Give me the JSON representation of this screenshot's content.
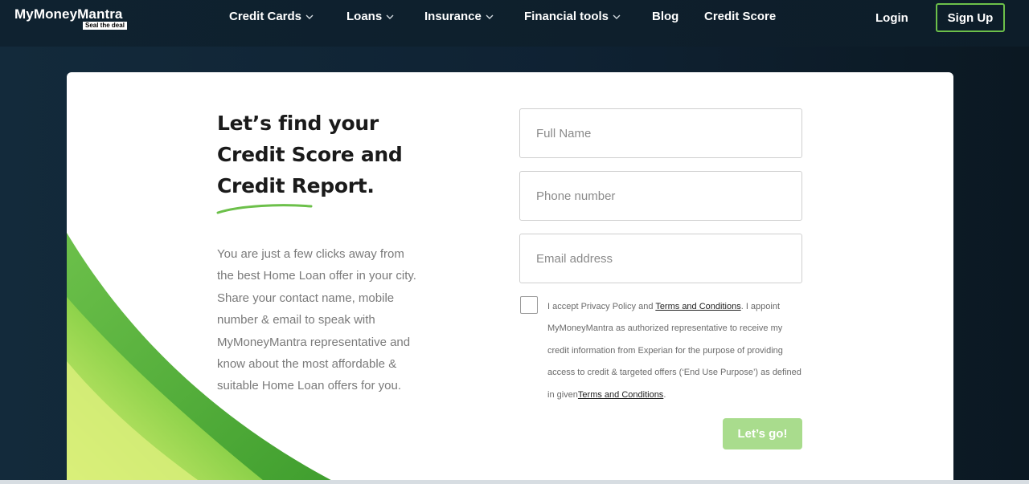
{
  "brand": {
    "name": "MyMoneyMantra",
    "tagline": "Seal the deal"
  },
  "nav": {
    "items": [
      {
        "label": "Credit Cards",
        "has_dropdown": true
      },
      {
        "label": "Loans",
        "has_dropdown": true
      },
      {
        "label": "Insurance",
        "has_dropdown": true
      },
      {
        "label": "Financial tools",
        "has_dropdown": true
      },
      {
        "label": "Blog",
        "has_dropdown": false
      },
      {
        "label": "Credit Score",
        "has_dropdown": false
      }
    ],
    "login_label": "Login",
    "signup_label": "Sign Up"
  },
  "hero": {
    "headline": "Let’s find your Credit Score and Credit Report.",
    "description": "You are just a few clicks away from the best Home Loan offer in your city. Share your contact name, mobile number & email to speak with MyMoneyMantra representative and know about the most affordable & suitable Home Loan offers for you."
  },
  "form": {
    "full_name_placeholder": "Full Name",
    "phone_placeholder": "Phone number",
    "email_placeholder": "Email address",
    "consent": {
      "text_1": "I accept Privacy Policy and ",
      "link_1": "Terms and Conditions",
      "text_2": ". I appoint MyMoneyMantra as authorized representative to receive my credit information from Experian for the purpose of providing access to credit & targeted offers (‘End Use Purpose’) as defined in given",
      "link_2": "Terms and Conditions",
      "text_3": "."
    },
    "submit_label": "Let’s go!"
  },
  "colors": {
    "accent_green": "#6cc04a",
    "button_green_disabled": "#a9dc8d",
    "header_bg": "#0f2230"
  },
  "icons": {
    "dropdown": "chevron-down-icon"
  }
}
